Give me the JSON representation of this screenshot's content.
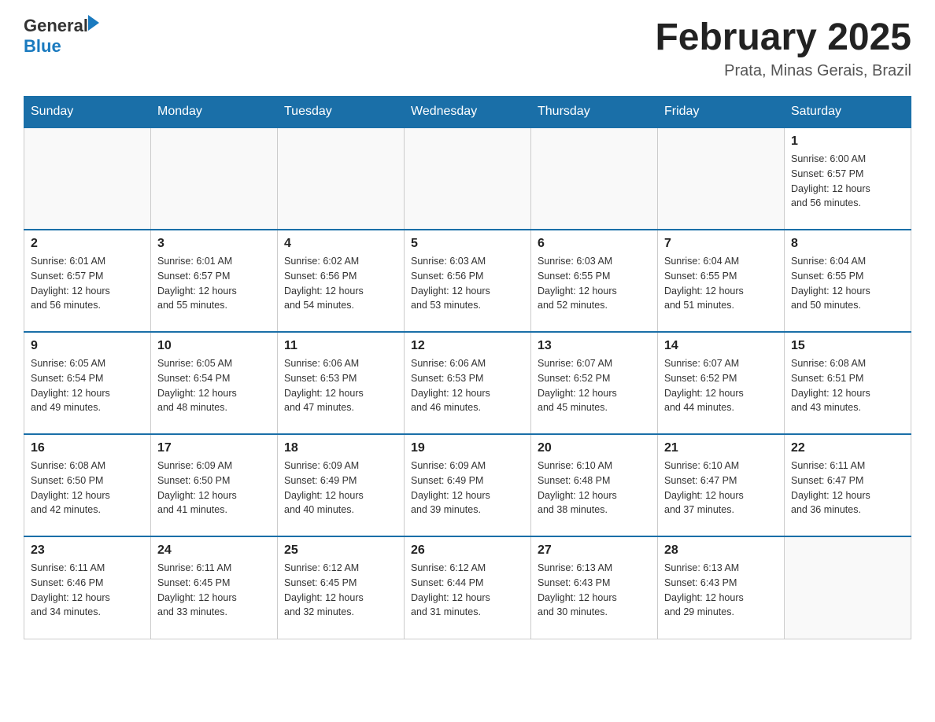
{
  "header": {
    "logo_general": "General",
    "logo_blue": "Blue",
    "month_title": "February 2025",
    "location": "Prata, Minas Gerais, Brazil"
  },
  "weekdays": [
    "Sunday",
    "Monday",
    "Tuesday",
    "Wednesday",
    "Thursday",
    "Friday",
    "Saturday"
  ],
  "weeks": [
    [
      {
        "day": "",
        "info": ""
      },
      {
        "day": "",
        "info": ""
      },
      {
        "day": "",
        "info": ""
      },
      {
        "day": "",
        "info": ""
      },
      {
        "day": "",
        "info": ""
      },
      {
        "day": "",
        "info": ""
      },
      {
        "day": "1",
        "info": "Sunrise: 6:00 AM\nSunset: 6:57 PM\nDaylight: 12 hours\nand 56 minutes."
      }
    ],
    [
      {
        "day": "2",
        "info": "Sunrise: 6:01 AM\nSunset: 6:57 PM\nDaylight: 12 hours\nand 56 minutes."
      },
      {
        "day": "3",
        "info": "Sunrise: 6:01 AM\nSunset: 6:57 PM\nDaylight: 12 hours\nand 55 minutes."
      },
      {
        "day": "4",
        "info": "Sunrise: 6:02 AM\nSunset: 6:56 PM\nDaylight: 12 hours\nand 54 minutes."
      },
      {
        "day": "5",
        "info": "Sunrise: 6:03 AM\nSunset: 6:56 PM\nDaylight: 12 hours\nand 53 minutes."
      },
      {
        "day": "6",
        "info": "Sunrise: 6:03 AM\nSunset: 6:55 PM\nDaylight: 12 hours\nand 52 minutes."
      },
      {
        "day": "7",
        "info": "Sunrise: 6:04 AM\nSunset: 6:55 PM\nDaylight: 12 hours\nand 51 minutes."
      },
      {
        "day": "8",
        "info": "Sunrise: 6:04 AM\nSunset: 6:55 PM\nDaylight: 12 hours\nand 50 minutes."
      }
    ],
    [
      {
        "day": "9",
        "info": "Sunrise: 6:05 AM\nSunset: 6:54 PM\nDaylight: 12 hours\nand 49 minutes."
      },
      {
        "day": "10",
        "info": "Sunrise: 6:05 AM\nSunset: 6:54 PM\nDaylight: 12 hours\nand 48 minutes."
      },
      {
        "day": "11",
        "info": "Sunrise: 6:06 AM\nSunset: 6:53 PM\nDaylight: 12 hours\nand 47 minutes."
      },
      {
        "day": "12",
        "info": "Sunrise: 6:06 AM\nSunset: 6:53 PM\nDaylight: 12 hours\nand 46 minutes."
      },
      {
        "day": "13",
        "info": "Sunrise: 6:07 AM\nSunset: 6:52 PM\nDaylight: 12 hours\nand 45 minutes."
      },
      {
        "day": "14",
        "info": "Sunrise: 6:07 AM\nSunset: 6:52 PM\nDaylight: 12 hours\nand 44 minutes."
      },
      {
        "day": "15",
        "info": "Sunrise: 6:08 AM\nSunset: 6:51 PM\nDaylight: 12 hours\nand 43 minutes."
      }
    ],
    [
      {
        "day": "16",
        "info": "Sunrise: 6:08 AM\nSunset: 6:50 PM\nDaylight: 12 hours\nand 42 minutes."
      },
      {
        "day": "17",
        "info": "Sunrise: 6:09 AM\nSunset: 6:50 PM\nDaylight: 12 hours\nand 41 minutes."
      },
      {
        "day": "18",
        "info": "Sunrise: 6:09 AM\nSunset: 6:49 PM\nDaylight: 12 hours\nand 40 minutes."
      },
      {
        "day": "19",
        "info": "Sunrise: 6:09 AM\nSunset: 6:49 PM\nDaylight: 12 hours\nand 39 minutes."
      },
      {
        "day": "20",
        "info": "Sunrise: 6:10 AM\nSunset: 6:48 PM\nDaylight: 12 hours\nand 38 minutes."
      },
      {
        "day": "21",
        "info": "Sunrise: 6:10 AM\nSunset: 6:47 PM\nDaylight: 12 hours\nand 37 minutes."
      },
      {
        "day": "22",
        "info": "Sunrise: 6:11 AM\nSunset: 6:47 PM\nDaylight: 12 hours\nand 36 minutes."
      }
    ],
    [
      {
        "day": "23",
        "info": "Sunrise: 6:11 AM\nSunset: 6:46 PM\nDaylight: 12 hours\nand 34 minutes."
      },
      {
        "day": "24",
        "info": "Sunrise: 6:11 AM\nSunset: 6:45 PM\nDaylight: 12 hours\nand 33 minutes."
      },
      {
        "day": "25",
        "info": "Sunrise: 6:12 AM\nSunset: 6:45 PM\nDaylight: 12 hours\nand 32 minutes."
      },
      {
        "day": "26",
        "info": "Sunrise: 6:12 AM\nSunset: 6:44 PM\nDaylight: 12 hours\nand 31 minutes."
      },
      {
        "day": "27",
        "info": "Sunrise: 6:13 AM\nSunset: 6:43 PM\nDaylight: 12 hours\nand 30 minutes."
      },
      {
        "day": "28",
        "info": "Sunrise: 6:13 AM\nSunset: 6:43 PM\nDaylight: 12 hours\nand 29 minutes."
      },
      {
        "day": "",
        "info": ""
      }
    ]
  ]
}
